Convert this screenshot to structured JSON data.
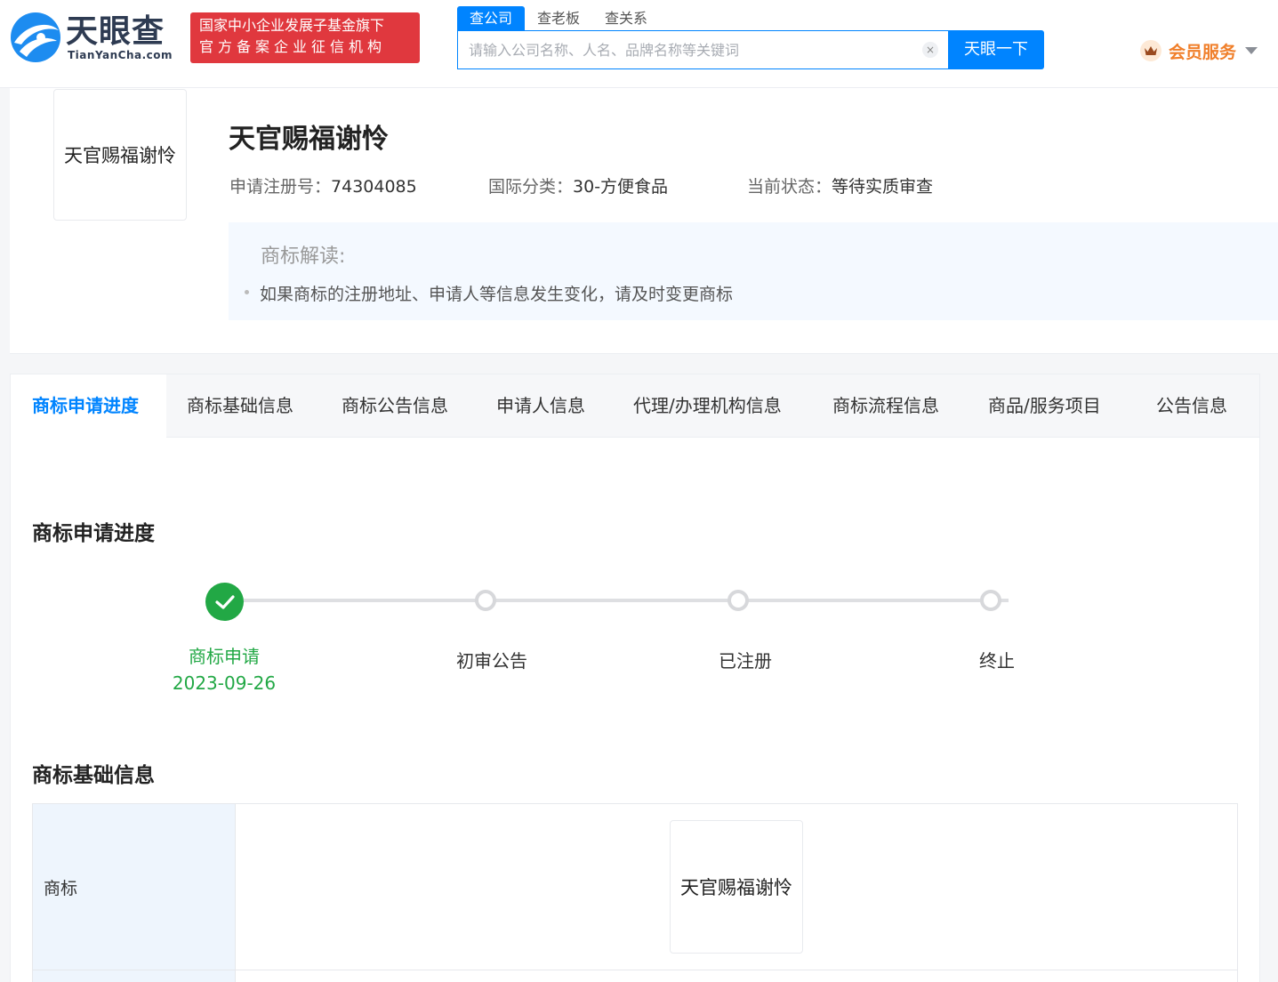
{
  "header": {
    "logo_cn": "天眼查",
    "logo_en": "TianYanCha.com",
    "badge_line1": "国家中小企业发展子基金旗下",
    "badge_line2": "官方备案企业征信机构",
    "search_tabs": [
      "查公司",
      "查老板",
      "查关系"
    ],
    "search_placeholder": "请输入公司名称、人名、品牌名称等关键词",
    "search_button": "天眼一下",
    "clear_symbol": "×",
    "member_label": "会员服务"
  },
  "trademark": {
    "image_text": "天官赐福谢怜",
    "name": "天官赐福谢怜",
    "reg_no_label": "申请注册号：",
    "reg_no": "74304085",
    "class_label": "国际分类：",
    "class_value": "30-方便食品",
    "status_label": "当前状态：",
    "status_value": "等待实质审查",
    "interp_title": "商标解读:",
    "interp_items": [
      "如果商标的注册地址、申请人等信息发生变化，请及时变更商标"
    ]
  },
  "tabs": [
    "商标申请进度",
    "商标基础信息",
    "商标公告信息",
    "申请人信息",
    "代理/办理机构信息",
    "商标流程信息",
    "商品/服务项目",
    "公告信息"
  ],
  "progress": {
    "title": "商标申请进度",
    "steps": [
      {
        "label": "商标申请",
        "date": "2023-09-26",
        "done": true
      },
      {
        "label": "初审公告",
        "date": "",
        "done": false
      },
      {
        "label": "已注册",
        "date": "",
        "done": false
      },
      {
        "label": "终止",
        "date": "",
        "done": false
      }
    ]
  },
  "basic_info": {
    "title": "商标基础信息",
    "rows": [
      {
        "label": "商标",
        "image_text": "天官赐福谢怜"
      }
    ]
  },
  "colors": {
    "accent": "#0084ff",
    "badge": "#e0383e",
    "success": "#22a845",
    "member": "#f07f2a"
  }
}
